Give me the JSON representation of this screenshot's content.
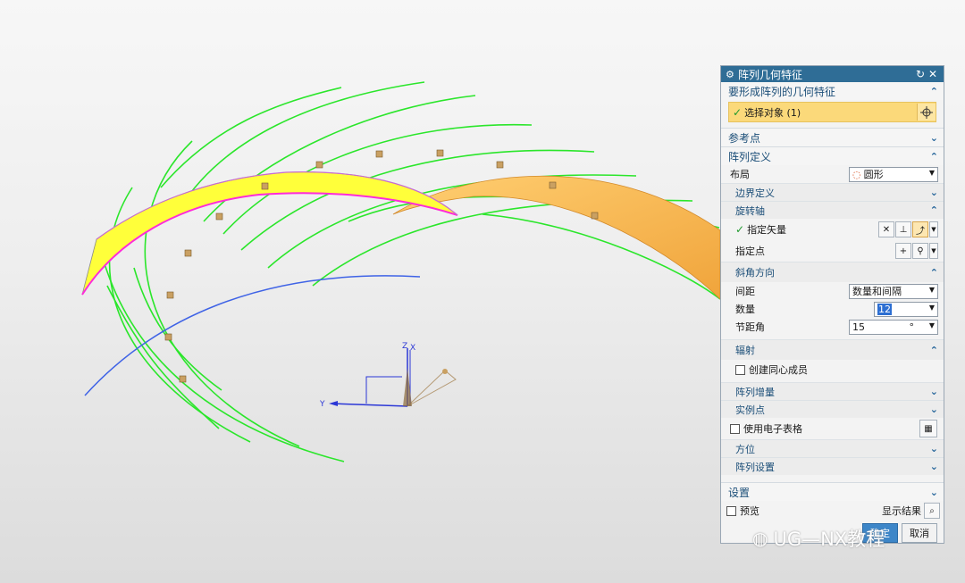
{
  "dialog": {
    "title": "阵列几何特征",
    "reset_glyph": "↻",
    "close_glyph": "✕",
    "section_geometry": "要形成阵列的几何特征",
    "select_object": "选择对象 (1)",
    "section_reference_point": "参考点",
    "section_array_definition": "阵列定义",
    "layout_label": "布局",
    "layout_value": "圆形",
    "boundary_definition": "边界定义",
    "rotation_axis": "旋转轴",
    "specify_vector": "指定矢量",
    "specify_point": "指定点",
    "angular_direction": "斜角方向",
    "spacing_label": "间距",
    "spacing_value": "数量和间隔",
    "count_label": "数量",
    "count_value": "12",
    "pitch_angle_label": "节距角",
    "pitch_angle_value": "15",
    "pitch_angle_unit": "°",
    "radiate": "辐射",
    "create_concentric": "创建同心成员",
    "array_increment": "阵列增量",
    "instance_point": "实例点",
    "use_spreadsheet": "使用电子表格",
    "orientation": "方位",
    "array_settings": "阵列设置",
    "section_settings": "设置",
    "preview": "预览",
    "show_result": "显示结果",
    "ok_button": "确定",
    "cancel_button": "取消"
  },
  "triad": {
    "x": "X",
    "y": "Y",
    "z": "Z"
  },
  "watermark": "UG—NX教程",
  "colors": {
    "title_bar": "#2f6d96",
    "selection_highlight": "#fbd97a",
    "green_curves": "#2be62b",
    "blue_curve": "#3f63e6",
    "yellow_face": "#ffff3a",
    "orange_face": "#f4b24c",
    "magenta_edge": "#ff2bd8"
  }
}
